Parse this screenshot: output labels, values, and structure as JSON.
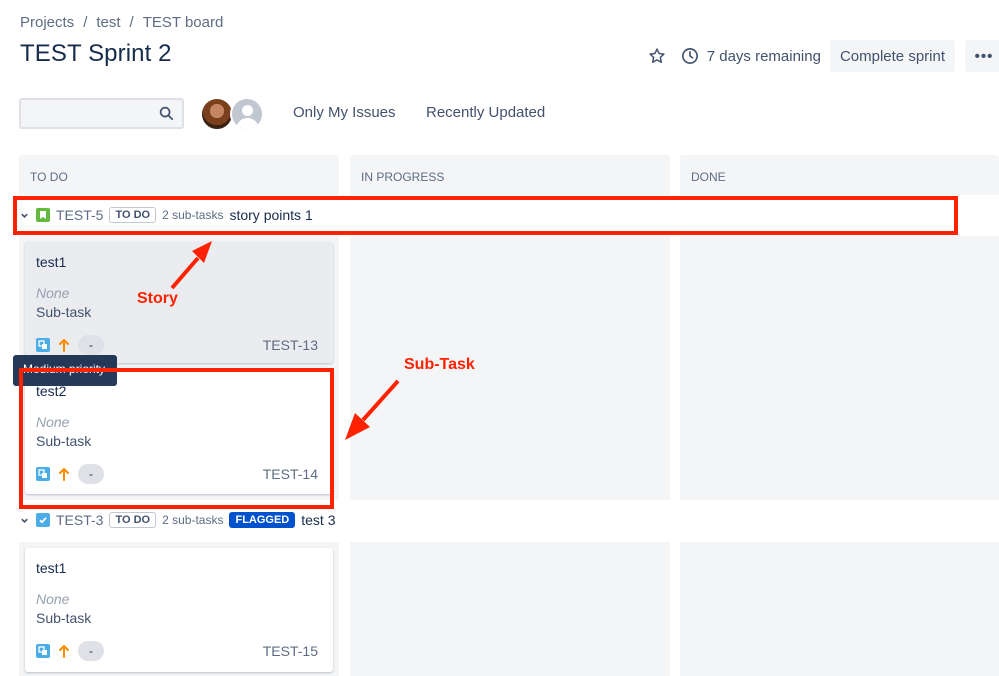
{
  "breadcrumbs": [
    "Projects",
    "test",
    "TEST board"
  ],
  "breadcrumb_separator": "/",
  "page_title": "TEST Sprint 2",
  "header": {
    "star_icon": "star-icon",
    "clock_icon": "clock-icon",
    "time_remaining": "7 days remaining",
    "complete_sprint_label": "Complete sprint",
    "more_label": "•••"
  },
  "filters": {
    "search_placeholder": "",
    "only_my_issues": "Only My Issues",
    "recently_updated": "Recently Updated"
  },
  "columns": [
    "TO DO",
    "IN PROGRESS",
    "DONE"
  ],
  "swimlanes": [
    {
      "key": "TEST-5",
      "issue_type_icon": "story-icon",
      "status": "TO DO",
      "subtask_count": "2 sub-tasks",
      "summary": "story points 1",
      "color": "#63ba3c",
      "cards": [
        {
          "title": "test1",
          "assignee_text": "None",
          "type": "Sub-task",
          "estimate": "-",
          "key": "TEST-13"
        },
        {
          "title": "test2",
          "assignee_text": "None",
          "type": "Sub-task",
          "estimate": "-",
          "key": "TEST-14"
        }
      ]
    },
    {
      "key": "TEST-3",
      "issue_type_icon": "task-icon",
      "status": "TO DO",
      "subtask_count": "2 sub-tasks",
      "flag": "FLAGGED",
      "summary": "test 3",
      "color": "#4bade8",
      "cards": [
        {
          "title": "test1",
          "assignee_text": "None",
          "type": "Sub-task",
          "estimate": "-",
          "key": "TEST-15"
        }
      ]
    }
  ],
  "tooltip": "Medium priority",
  "annotations": {
    "story_label": "Story",
    "subtask_label": "Sub-Task",
    "color": "#ff2200"
  },
  "colors": {
    "priority_medium": "#ff8b00",
    "flagged_bg": "#0052cc",
    "lane_bg": "#f4f5f7"
  }
}
